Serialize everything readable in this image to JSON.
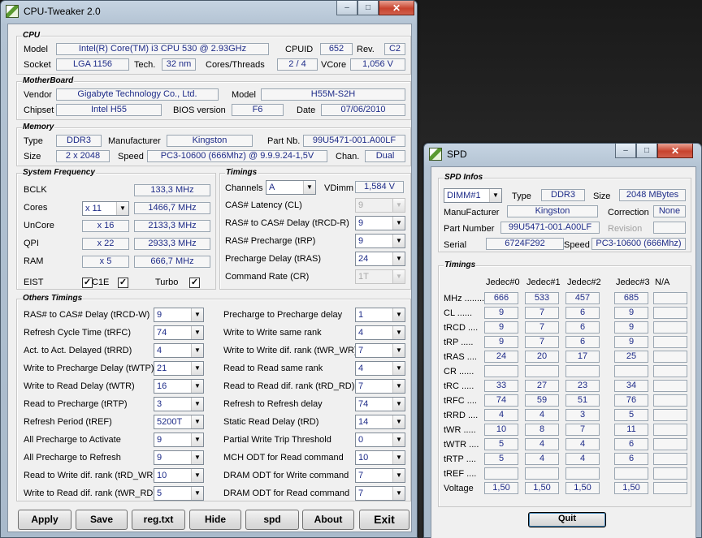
{
  "main": {
    "title": "CPU-Tweaker 2.0",
    "caption": {
      "minimize": "–",
      "maximize": "□",
      "close": "✕"
    },
    "cpu": {
      "group": "CPU",
      "model_label": "Model",
      "model": "Intel(R) Core(TM) i3 CPU        530  @ 2.93GHz",
      "cpuid_label": "CPUID",
      "cpuid": "652",
      "rev_label": "Rev.",
      "rev": "C2",
      "socket_label": "Socket",
      "socket": "LGA 1156",
      "tech_label": "Tech.",
      "tech": "32 nm",
      "cores_threads_label": "Cores/Threads",
      "cores_threads": "2 / 4",
      "vcore_label": "VCore",
      "vcore": "1,056 V"
    },
    "motherboard": {
      "group": "MotherBoard",
      "vendor_label": "Vendor",
      "vendor": "Gigabyte Technology Co., Ltd.",
      "model_label": "Model",
      "model": "H55M-S2H",
      "chipset_label": "Chipset",
      "chipset": "Intel H55",
      "bios_label": "BIOS version",
      "bios": "F6",
      "date_label": "Date",
      "date": "07/06/2010"
    },
    "memory": {
      "group": "Memory",
      "type_label": "Type",
      "type": "DDR3",
      "manufacturer_label": "Manufacturer",
      "manufacturer": "Kingston",
      "partnb_label": "Part Nb.",
      "partnb": "99U5471-001.A00LF",
      "size_label": "Size",
      "size": "2 x 2048",
      "speed_label": "Speed",
      "speed": "PC3-10600 (666Mhz) @ 9.9.9.24-1,5V",
      "chan_label": "Chan.",
      "chan": "Dual"
    },
    "sysfreq": {
      "group": "System Frequency",
      "bclk_label": "BCLK",
      "bclk": "133,3 MHz",
      "cores_label": "Cores",
      "cores_mult": "x 11",
      "cores": "1466,7 MHz",
      "uncore_label": "UnCore",
      "uncore_mult": "x 16",
      "uncore": "2133,3 MHz",
      "qpi_label": "QPI",
      "qpi_mult": "x 22",
      "qpi": "2933,3 MHz",
      "ram_label": "RAM",
      "ram_mult": "x 5",
      "ram": "666,7 MHz",
      "eist_label": "EIST",
      "c1e_label": "C1E",
      "turbo_label": "Turbo",
      "check_mark": "✓"
    },
    "timings": {
      "group": "Timings",
      "channels_label": "Channels",
      "channels": "A",
      "vdimm_label": "VDimm",
      "vdimm": "1,584 V",
      "rows": [
        {
          "label": "CAS# Latency (CL)",
          "value": "9",
          "disabled": true
        },
        {
          "label": "RAS# to CAS# Delay (tRCD-R)",
          "value": "9",
          "disabled": false
        },
        {
          "label": "RAS# Precharge (tRP)",
          "value": "9",
          "disabled": false
        },
        {
          "label": "Precharge Delay (tRAS)",
          "value": "24",
          "disabled": false
        },
        {
          "label": "Command Rate (CR)",
          "value": "1T",
          "disabled": true
        }
      ]
    },
    "other": {
      "group": "Others Timings",
      "left": [
        {
          "label": "RAS# to CAS# Delay (tRCD-W)",
          "value": "9"
        },
        {
          "label": "Refresh Cycle Time (tRFC)",
          "value": "74"
        },
        {
          "label": "Act. to Act. Delayed (tRRD)",
          "value": "4"
        },
        {
          "label": "Write to Precharge Delay (tWTP)",
          "value": "21"
        },
        {
          "label": "Write to Read Delay (tWTR)",
          "value": "16"
        },
        {
          "label": "Read to Precharge (tRTP)",
          "value": "3"
        },
        {
          "label": "Refresh Period (tREF)",
          "value": "5200T"
        },
        {
          "label": "All Precharge to Activate",
          "value": "9"
        },
        {
          "label": "All Precharge to Refresh",
          "value": "9"
        },
        {
          "label": "Read to Write dif. rank (tRD_WR)",
          "value": "10"
        },
        {
          "label": "Write to Read dif. rank (tWR_RD)",
          "value": "5"
        }
      ],
      "right": [
        {
          "label": "Precharge to Precharge delay",
          "value": "1"
        },
        {
          "label": "Write to Write same rank",
          "value": "4"
        },
        {
          "label": "Write to Write dif. rank (tWR_WR)",
          "value": "7"
        },
        {
          "label": "Read to Read same rank",
          "value": "4"
        },
        {
          "label": "Read to Read dif. rank (tRD_RD)",
          "value": "7"
        },
        {
          "label": "Refresh to Refresh delay",
          "value": "74"
        },
        {
          "label": "Static Read Delay (tRD)",
          "value": "14"
        },
        {
          "label": "Partial Write Trip Threshold",
          "value": "0"
        },
        {
          "label": "MCH ODT for Read command",
          "value": "10"
        },
        {
          "label": "DRAM ODT for Write command",
          "value": "7"
        },
        {
          "label": "DRAM ODT for Read command",
          "value": "7"
        }
      ]
    },
    "buttons": {
      "apply": "Apply",
      "save": "Save",
      "regtxt": "reg.txt",
      "hide": "Hide",
      "spd": "spd",
      "about": "About",
      "exit": "Exit"
    }
  },
  "spd": {
    "title": "SPD",
    "caption": {
      "minimize": "–",
      "maximize": "□",
      "close": "✕"
    },
    "infos": {
      "group": "SPD Infos",
      "dimm": "DIMM#1",
      "type_label": "Type",
      "type": "DDR3",
      "size_label": "Size",
      "size": "2048 MBytes",
      "manufacturer_label": "ManuFacturer",
      "manufacturer": "Kingston",
      "correction_label": "Correction",
      "correction": "None",
      "partnumber_label": "Part Number",
      "partnumber": "99U5471-001.A00LF",
      "revision_label": "Revision",
      "revision": "",
      "serial_label": "Serial",
      "serial": "6724F292",
      "speed_label": "Speed",
      "speed": "PC3-10600 (666Mhz)"
    },
    "timings": {
      "group": "Timings",
      "columns": [
        "Jedec#0",
        "Jedec#1",
        "Jedec#2",
        "Jedec#3",
        "N/A"
      ],
      "rows": [
        {
          "label": "MHz ..........",
          "values": [
            "666",
            "533",
            "457",
            "685",
            ""
          ]
        },
        {
          "label": "CL ......",
          "values": [
            "9",
            "7",
            "6",
            "9",
            ""
          ]
        },
        {
          "label": "tRCD ....",
          "values": [
            "9",
            "7",
            "6",
            "9",
            ""
          ]
        },
        {
          "label": "tRP .....",
          "values": [
            "9",
            "7",
            "6",
            "9",
            ""
          ]
        },
        {
          "label": "tRAS ....",
          "values": [
            "24",
            "20",
            "17",
            "25",
            ""
          ]
        },
        {
          "label": "CR ......",
          "values": [
            "",
            "",
            "",
            "",
            ""
          ]
        },
        {
          "label": "tRC .....",
          "values": [
            "33",
            "27",
            "23",
            "34",
            ""
          ]
        },
        {
          "label": "tRFC ....",
          "values": [
            "74",
            "59",
            "51",
            "76",
            ""
          ]
        },
        {
          "label": "tRRD ....",
          "values": [
            "4",
            "4",
            "3",
            "5",
            ""
          ]
        },
        {
          "label": "tWR .....",
          "values": [
            "10",
            "8",
            "7",
            "11",
            ""
          ]
        },
        {
          "label": "tWTR ....",
          "values": [
            "5",
            "4",
            "4",
            "6",
            ""
          ]
        },
        {
          "label": "tRTP ....",
          "values": [
            "5",
            "4",
            "4",
            "6",
            ""
          ]
        },
        {
          "label": "tREF ....",
          "values": [
            "",
            "",
            "",
            "",
            ""
          ]
        },
        {
          "label": "Voltage",
          "values": [
            "1,50",
            "1,50",
            "1,50",
            "1,50",
            ""
          ]
        }
      ]
    },
    "quit": "Quit"
  },
  "colors": {
    "value_text": "#1d2b88",
    "close_button": "#c8432e",
    "window_frame": "#b3c3d3",
    "client_bg": "#f0f0f0"
  }
}
